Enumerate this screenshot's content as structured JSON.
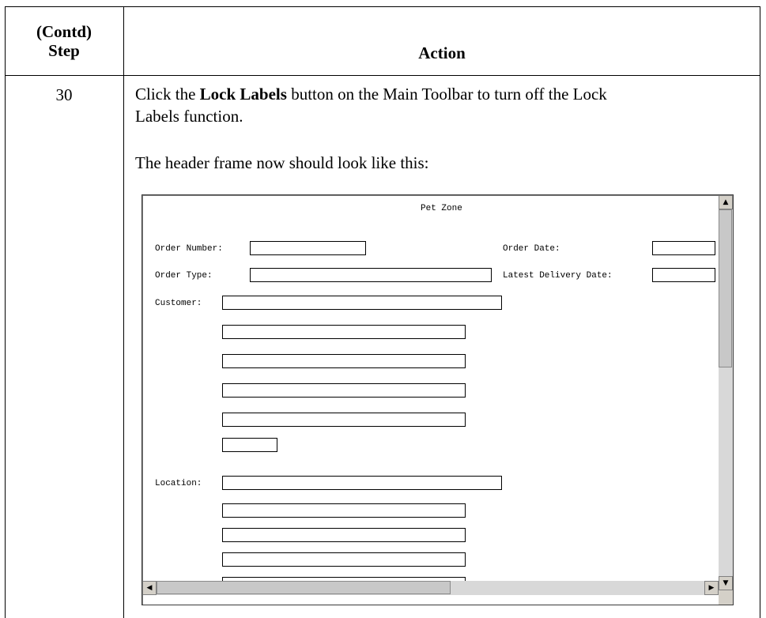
{
  "table": {
    "header": {
      "step_line1": "(Contd)",
      "step_line2": "Step",
      "action": "Action"
    },
    "row": {
      "step": "30",
      "instruction_pre": "Click the ",
      "instruction_bold": "Lock Labels",
      "instruction_post": " button on the Main Toolbar to turn off the Lock",
      "instruction_line2": "Labels function.",
      "result_text": "The header frame now should look like this:"
    }
  },
  "form": {
    "title": "Pet Zone",
    "order_number_label": "Order Number:",
    "order_date_label": "Order Date:",
    "order_type_label": "Order Type:",
    "latest_delivery_label": "Latest Delivery Date:",
    "customer_label": "Customer:",
    "location_label": "Location:"
  },
  "scrollbar_icons": {
    "up": "▲",
    "down": "▼",
    "left": "◀",
    "right": "▶"
  }
}
